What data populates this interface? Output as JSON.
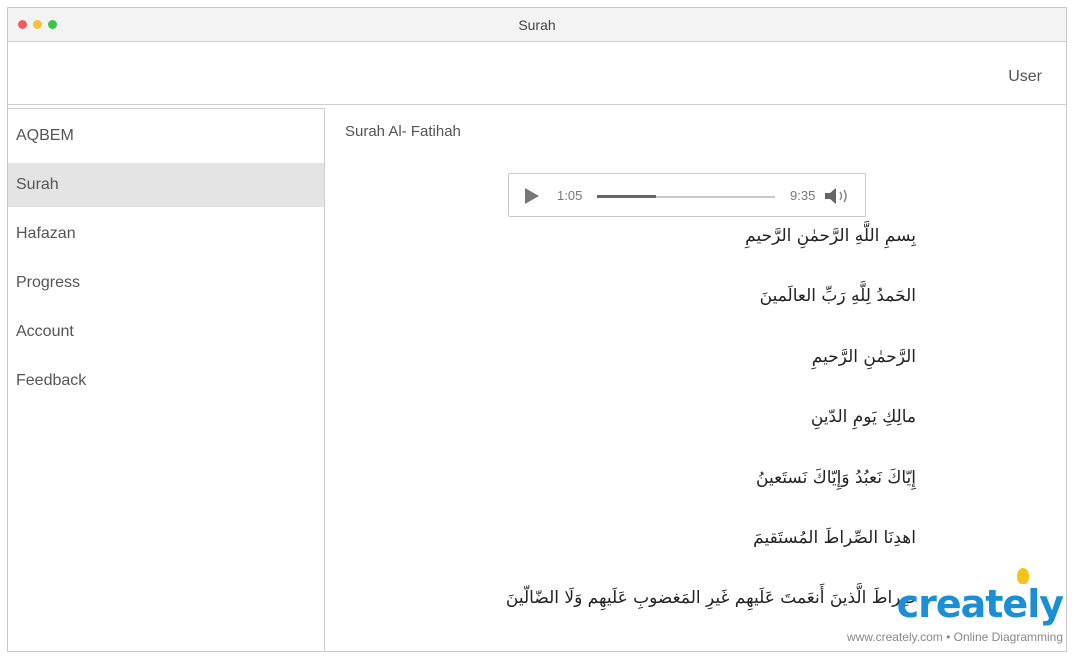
{
  "window": {
    "title": "Surah"
  },
  "header": {
    "user_label": "User"
  },
  "sidebar": {
    "items": [
      {
        "label": "AQBEM",
        "active": false
      },
      {
        "label": "Surah",
        "active": true
      },
      {
        "label": "Hafazan",
        "active": false
      },
      {
        "label": "Progress",
        "active": false
      },
      {
        "label": "Account",
        "active": false
      },
      {
        "label": "Feedback",
        "active": false
      }
    ]
  },
  "main": {
    "title": "Surah Al- Fatihah",
    "player": {
      "current_time": "1:05",
      "total_time": "9:35",
      "progress": 0.33,
      "play_icon": "play-icon",
      "volume_icon": "volume-icon"
    },
    "verses": [
      "بِسمِ اللَّهِ الرَّحمٰنِ الرَّحيمِ",
      "الحَمدُ لِلَّهِ رَبِّ العالَمينَ",
      "الرَّحمٰنِ الرَّحيمِ",
      "مالِكِ يَومِ الدّينِ",
      "إِيّاكَ نَعبُدُ وَإِيّاكَ نَستَعينُ",
      "اهدِنَا الصِّراطَ المُستَقيمَ",
      "صِراطَ الَّذينَ أَنعَمتَ عَلَيهِم غَيرِ المَغضوبِ عَلَيهِم وَلَا الضّالّينَ"
    ]
  },
  "watermark": {
    "logo": "creately",
    "caption": "www.creately.com • Online Diagramming"
  },
  "colors": {
    "close": "#f05d5d",
    "minimize": "#f5c33b",
    "maximize": "#3ec24a",
    "active_item_bg": "#e4e4e4",
    "watermark_blue": "#1a8fd6"
  }
}
